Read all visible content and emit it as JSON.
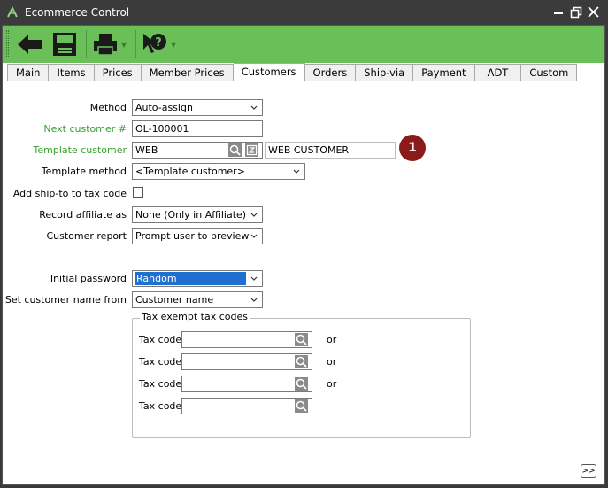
{
  "window": {
    "title": "Ecommerce Control"
  },
  "toolbar": {
    "buttons": [
      {
        "name": "back-arrow-icon"
      },
      {
        "name": "save-icon"
      },
      {
        "name": "print-icon"
      },
      {
        "name": "help-cursor-icon"
      }
    ]
  },
  "tabs": [
    "Main",
    "Items",
    "Prices",
    "Member Prices",
    "Customers",
    "Orders",
    "Ship-via",
    "Payment",
    "ADT",
    "Custom"
  ],
  "active_tab": "Customers",
  "form": {
    "method": {
      "label": "Method",
      "value": "Auto-assign"
    },
    "next_customer": {
      "label": "Next customer #",
      "value": "OL-100001"
    },
    "template_customer": {
      "label": "Template customer",
      "value": "WEB",
      "description": "WEB CUSTOMER"
    },
    "template_method": {
      "label": "Template method",
      "value": "<Template customer>"
    },
    "add_ship_to": {
      "label": "Add ship-to to tax code",
      "checked": false
    },
    "record_affiliate": {
      "label": "Record affiliate as",
      "value": "None (Only in Affiliate)"
    },
    "customer_report": {
      "label": "Customer report",
      "value": "Prompt user to preview"
    },
    "initial_password": {
      "label": "Initial password",
      "value": "Random"
    },
    "set_customer_name": {
      "label": "Set customer name from",
      "value": "Customer name"
    }
  },
  "tax_exempt": {
    "title": "Tax exempt tax codes",
    "rows": [
      {
        "label": "Tax code",
        "value": "",
        "suffix": "or"
      },
      {
        "label": "Tax code",
        "value": "",
        "suffix": "or"
      },
      {
        "label": "Tax code",
        "value": "",
        "suffix": "or"
      },
      {
        "label": "Tax code",
        "value": "",
        "suffix": ""
      }
    ]
  },
  "badge": "1",
  "more_button": ">>",
  "colors": {
    "toolbar": "#6abf59",
    "title_bar": "#3b3b3b",
    "badge": "#8b1a1a",
    "label_green": "#3aa030",
    "selection": "#1f6fd1"
  }
}
